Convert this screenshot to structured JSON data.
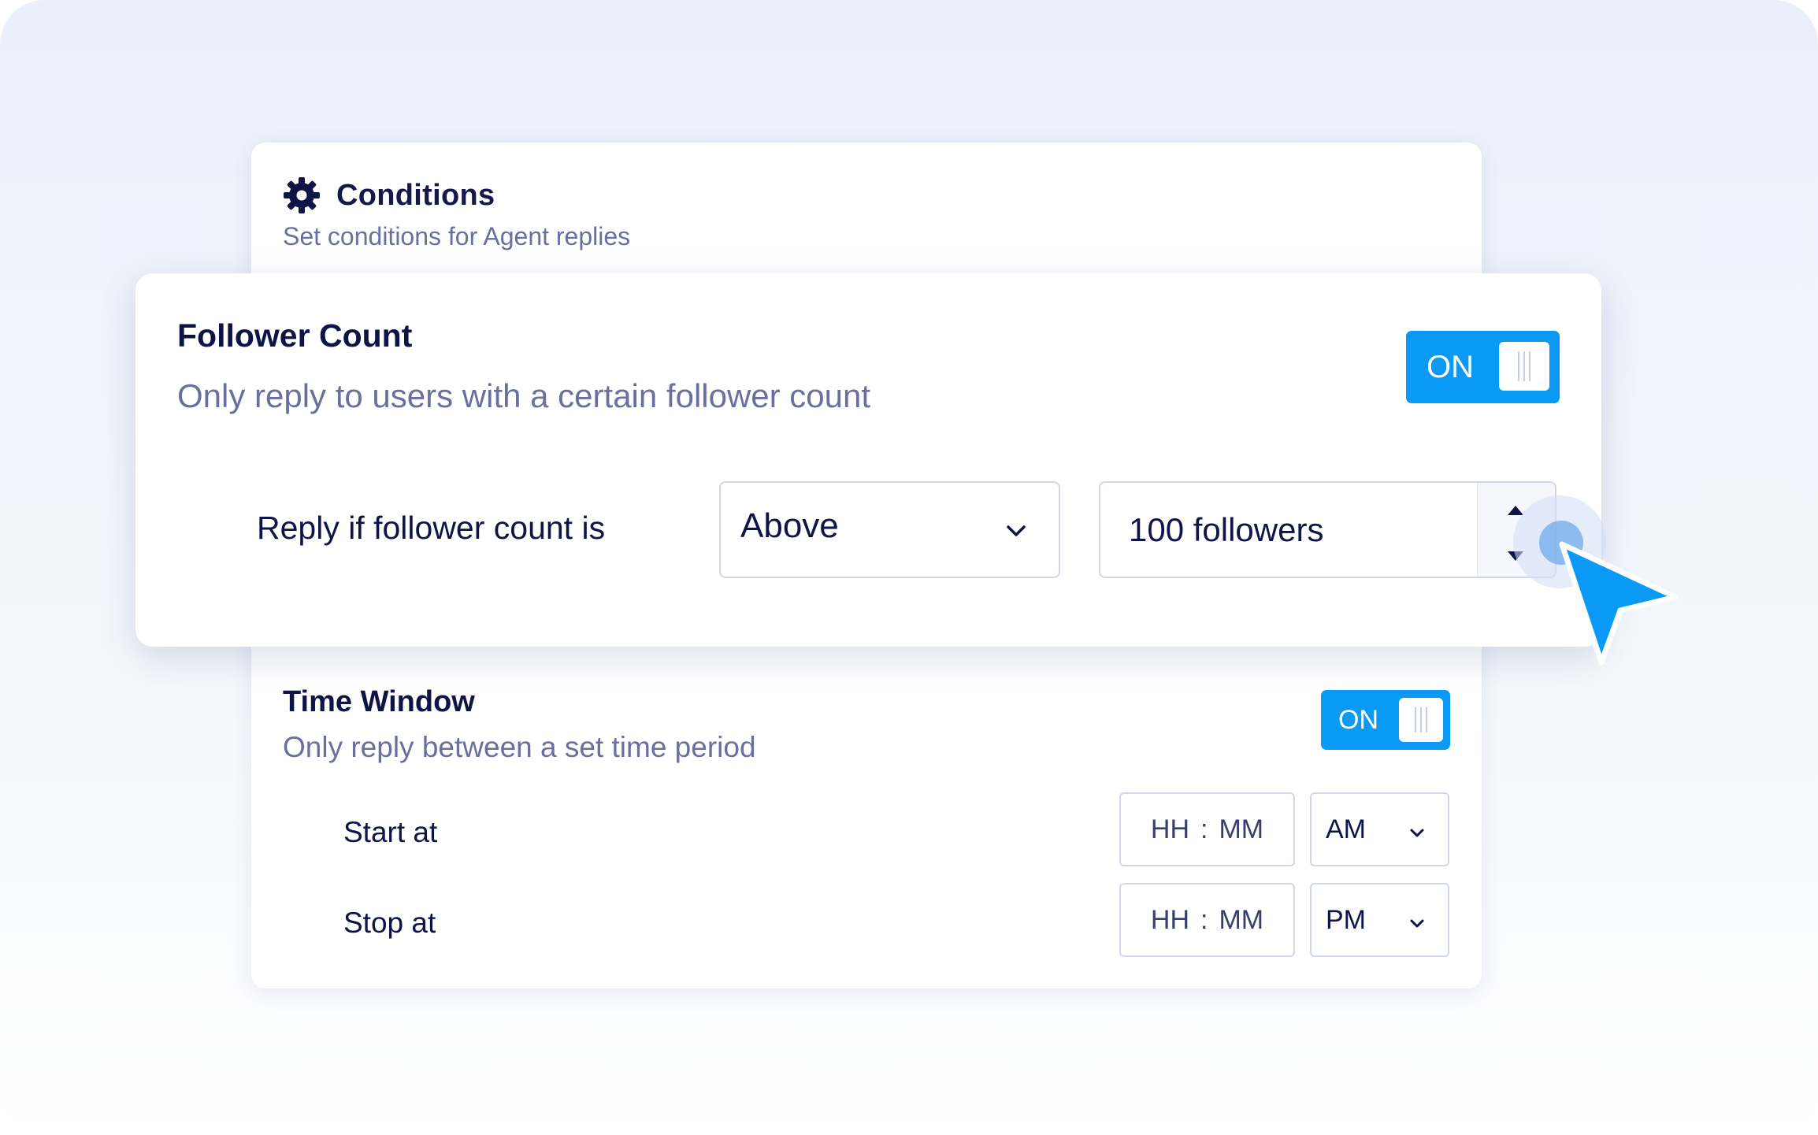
{
  "conditions": {
    "title": "Conditions",
    "subtitle": "Set conditions for Agent replies"
  },
  "follower_count": {
    "title": "Follower Count",
    "description": "Only reply to users with a certain follower count",
    "toggle_label": "ON",
    "rule_label": "Reply if follower count is",
    "comparator": "Above",
    "threshold": "100 followers"
  },
  "time_window": {
    "title": "Time Window",
    "description": "Only reply between a set time period",
    "toggle_label": "ON",
    "start": {
      "label": "Start at",
      "hh": "HH",
      "sep": ":",
      "mm": "MM",
      "period": "AM"
    },
    "stop": {
      "label": "Stop at",
      "hh": "HH",
      "sep": ":",
      "mm": "MM",
      "period": "PM"
    }
  },
  "colors": {
    "accent": "#0a99f5",
    "heading": "#0f1446",
    "muted": "#6a6f9e",
    "border": "#d2d6ea"
  },
  "icons": [
    "gear-icon",
    "chevron-down-icon",
    "caret-up-icon",
    "caret-down-icon",
    "cursor-pointer-icon",
    "toggle-grip-icon"
  ]
}
